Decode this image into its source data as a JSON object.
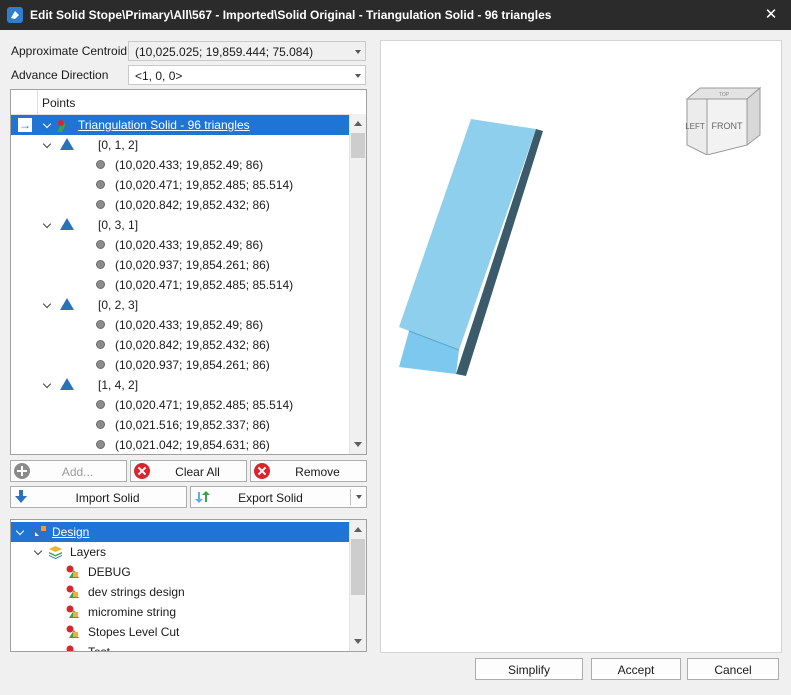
{
  "window": {
    "title": "Edit Solid  Stope\\Primary\\All\\567 - Imported\\Solid Original - Triangulation Solid - 96 triangles",
    "close_glyph": "✕"
  },
  "fields": {
    "centroid_label": "Approximate Centroid",
    "centroid_value": "(10,025.025; 19,859.444; 75.084)",
    "direction_label": "Advance Direction",
    "direction_value": "<1, 0, 0>"
  },
  "points_tree": {
    "header": "Points",
    "root_arrow": "→",
    "root_label": "Triangulation Solid - 96 triangles",
    "groups": [
      {
        "label": "[0, 1, 2]",
        "points": [
          "(10,020.433; 19,852.49; 86)",
          "(10,020.471; 19,852.485; 85.514)",
          "(10,020.842; 19,852.432; 86)"
        ]
      },
      {
        "label": "[0, 3, 1]",
        "points": [
          "(10,020.433; 19,852.49; 86)",
          "(10,020.937; 19,854.261; 86)",
          "(10,020.471; 19,852.485; 85.514)"
        ]
      },
      {
        "label": "[0, 2, 3]",
        "points": [
          "(10,020.433; 19,852.49; 86)",
          "(10,020.842; 19,852.432; 86)",
          "(10,020.937; 19,854.261; 86)"
        ]
      },
      {
        "label": "[1, 4, 2]",
        "points": [
          "(10,020.471; 19,852.485; 85.514)",
          "(10,021.516; 19,852.337; 86)",
          "(10,021.042; 19,854.631; 86)"
        ]
      }
    ]
  },
  "buttons": {
    "add": "Add...",
    "clear_all": "Clear All",
    "remove": "Remove",
    "import_solid": "Import Solid",
    "export_solid": "Export Solid",
    "simplify": "Simplify",
    "accept": "Accept",
    "cancel": "Cancel"
  },
  "layers_tree": {
    "root_label": "Design",
    "layers_label": "Layers",
    "items": [
      "DEBUG",
      "dev strings design",
      "micromine string",
      "Stopes Level Cut",
      "Test"
    ]
  },
  "view_cube": {
    "top": "TOP",
    "left": "LEFT",
    "front": "FRONT"
  },
  "colors": {
    "title_bar": "#2b2b2b",
    "selection": "#1f74d6",
    "solid_face": "#8fcfee",
    "solid_edge": "#3b5b6a",
    "triangle_icon": "#2f6fc2",
    "remove_icon": "#d8262c"
  },
  "icons": {
    "app": "solid-app-icon",
    "triangle": "triangle-icon",
    "point": "point-dot-icon",
    "design": "design-icon",
    "layers": "layers-icon",
    "layer": "layer-shapes-icon"
  }
}
